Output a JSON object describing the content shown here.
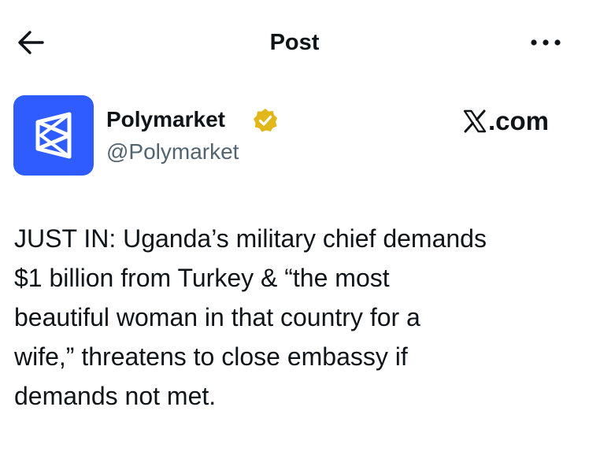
{
  "header": {
    "title": "Post",
    "back_icon": "arrow-left-icon",
    "more_icon": "more-horizontal-icon"
  },
  "author": {
    "name": "Polymarket",
    "handle": "@Polymarket",
    "verified": true,
    "avatar_color": "#2e5cff",
    "verified_color": "#e2b719"
  },
  "watermark": {
    "text": ".com",
    "logo_icon": "x-logo-icon"
  },
  "post": {
    "text": "JUST IN: Uganda’s military chief demands\n$1 billion from Turkey & “the most\nbeautiful woman in that country for a\nwife,” threatens to close embassy if\ndemands not met."
  }
}
